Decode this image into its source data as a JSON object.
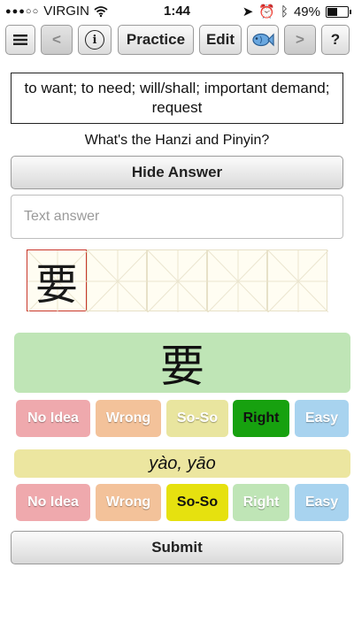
{
  "status": {
    "carrier": "VIRGIN",
    "time": "1:44",
    "battery": "49%",
    "battery_level": 0.49
  },
  "toolbar": {
    "menu_icon": "menu-icon",
    "back": "<",
    "info": "i",
    "practice": "Practice",
    "edit": "Edit",
    "fish_icon": "fish-icon",
    "forward": ">",
    "help": "?"
  },
  "card": {
    "prompt": "to want; to need; will/shall; important demand; request",
    "question": "What's the Hanzi and Pinyin?",
    "hide_answer": "Hide Answer",
    "text_answer_placeholder": "Text answer",
    "written_char": "要",
    "answer_hanzi": "要",
    "answer_pinyin": "yào, yāo"
  },
  "ratings": {
    "labels": [
      "No Idea",
      "Wrong",
      "So-So",
      "Right",
      "Easy"
    ],
    "hanzi_selected": "Right",
    "pinyin_selected": "So-So"
  },
  "colors": {
    "no_idea": "#efa9ad",
    "wrong": "#f3c29a",
    "soso": "#e9e59f",
    "right": "#bfe5b6",
    "easy": "#a8d3ef",
    "right_selected": "#17a10f",
    "soso_selected": "#e6e10f"
  },
  "submit": "Submit"
}
